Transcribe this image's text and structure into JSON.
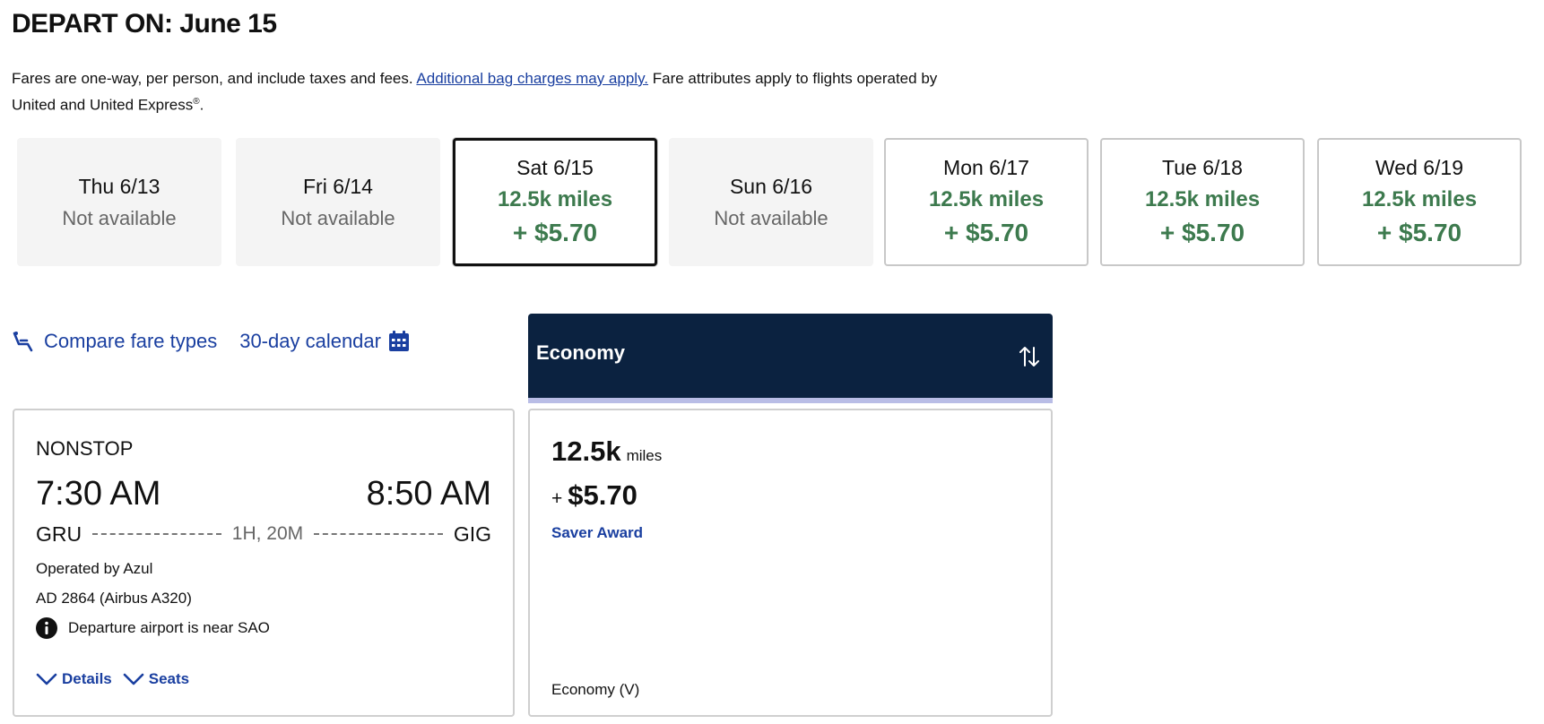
{
  "header": {
    "title": "DEPART ON: June 15"
  },
  "intro": {
    "text_before": "Fares are one-way, per person, and include taxes and fees. ",
    "bag_link": "Additional bag charges may apply.",
    "text_after": " Fare attributes apply to flights operated by United and United Express",
    "registered_mark": "®",
    "period": "."
  },
  "dates": [
    {
      "day": "Thu 6/13",
      "status": "Not available"
    },
    {
      "day": "Fri 6/14",
      "status": "Not available"
    },
    {
      "day": "Sat 6/15",
      "miles": "12.5k miles",
      "price": "+ $5.70"
    },
    {
      "day": "Sun 6/16",
      "status": "Not available"
    },
    {
      "day": "Mon 6/17",
      "miles": "12.5k miles",
      "price": "+ $5.70"
    },
    {
      "day": "Tue 6/18",
      "miles": "12.5k miles",
      "price": "+ $5.70"
    },
    {
      "day": "Wed 6/19",
      "miles": "12.5k miles",
      "price": "+ $5.70"
    }
  ],
  "tools": {
    "compare_label": "Compare fare types",
    "calendar_label": "30-day calendar"
  },
  "flight": {
    "stops": "NONSTOP",
    "depart_time": "7:30 AM",
    "arrive_time": "8:50 AM",
    "origin": "GRU",
    "destination": "GIG",
    "duration": "1H, 20M",
    "operator": "Operated by Azul",
    "flight_number": "AD 2864 (Airbus A320)",
    "notice": "Departure airport is near SAO",
    "details_label": "Details",
    "seats_label": "Seats"
  },
  "cabin": {
    "name": "Economy"
  },
  "fare": {
    "miles": "12.5k",
    "miles_unit": "miles",
    "plus": "+",
    "tax": "$5.70",
    "type": "Saver Award",
    "class": "Economy (V)"
  },
  "colors": {
    "accent_green": "#3d7a4e",
    "link_blue": "#1a3fa0",
    "header_navy": "#0b2240",
    "header_underline": "#b9bde6"
  },
  "icons": {
    "compare": "seat-icon",
    "calendar": "calendar-icon",
    "notice": "info-icon",
    "expand": "chevron-down-icon",
    "sort": "sort-icon"
  }
}
